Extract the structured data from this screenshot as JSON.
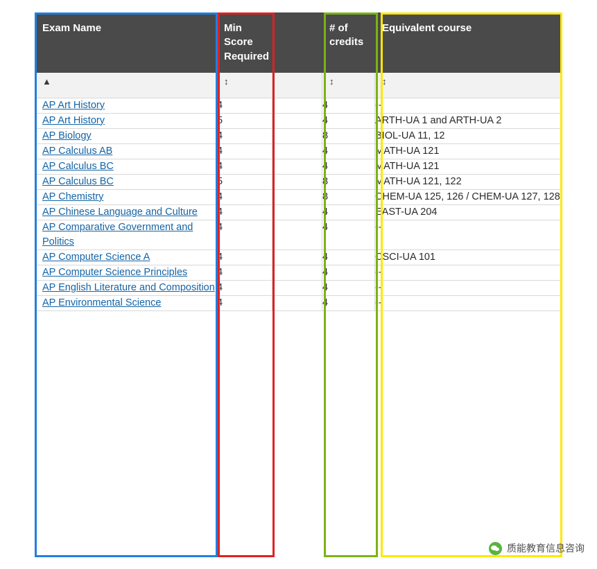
{
  "table": {
    "columns": [
      {
        "key": "exam",
        "label": "Exam Name",
        "sort_icon": "sort-asc-icon",
        "highlight": "#1f7fe0"
      },
      {
        "key": "min",
        "label": "Min Score Required",
        "sort_icon": "sort-both-icon",
        "highlight": "#e02020"
      },
      {
        "key": "gap",
        "label": "",
        "sort_icon": "",
        "highlight": ""
      },
      {
        "key": "cred",
        "label": "# of credits",
        "sort_icon": "sort-both-icon",
        "highlight": "#7ab317"
      },
      {
        "key": "equiv",
        "label": "Equivalent course",
        "sort_icon": "sort-both-icon",
        "highlight": "#ffe800"
      }
    ],
    "header_help_icon": "?",
    "rows": [
      {
        "exam": "AP Art History",
        "min": "4",
        "cred": "4",
        "equiv": "--"
      },
      {
        "exam": "AP Art History",
        "min": "5",
        "cred": "4",
        "equiv": "ARTH-UA 1 and ARTH-UA 2"
      },
      {
        "exam": "AP Biology",
        "min": "4",
        "cred": "8",
        "equiv": "BIOL-UA 11, 12"
      },
      {
        "exam": "AP Calculus AB",
        "min": "4",
        "cred": "4",
        "equiv": "MATH-UA 121"
      },
      {
        "exam": "AP Calculus BC",
        "min": "4",
        "cred": "4",
        "equiv": "MATH-UA 121"
      },
      {
        "exam": "AP Calculus BC",
        "min": "5",
        "cred": "8",
        "equiv": "MATH-UA 121, 122"
      },
      {
        "exam": "AP Chemistry",
        "min": "4",
        "cred": "8",
        "equiv": "CHEM-UA 125, 126 / CHEM-UA 127, 128"
      },
      {
        "exam": "AP Chinese Language and Culture",
        "min": "4",
        "cred": "4",
        "equiv": "EAST-UA 204"
      },
      {
        "exam": "AP Comparative Government and Politics",
        "min": "4",
        "cred": "4",
        "equiv": "--"
      },
      {
        "exam": "AP Computer Science A",
        "min": "4",
        "cred": "4",
        "equiv": "CSCI-UA 101"
      },
      {
        "exam": "AP Computer Science Principles",
        "min": "4",
        "cred": "4",
        "equiv": "--"
      },
      {
        "exam": "AP English Literature and Composition",
        "min": "4",
        "cred": "4",
        "equiv": "--"
      },
      {
        "exam": "AP Environmental Science",
        "min": "4",
        "cred": "4",
        "equiv": "--"
      }
    ]
  },
  "watermark": {
    "text": "质能教育信息咨询",
    "logo": "wechat-logo-icon"
  }
}
